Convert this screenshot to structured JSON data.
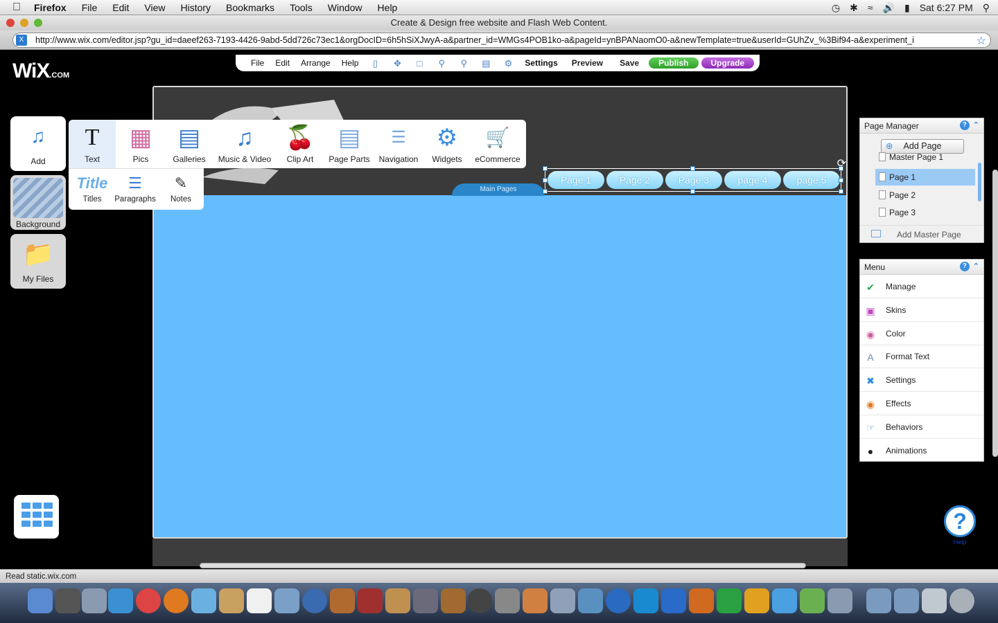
{
  "menubar": {
    "apple": "",
    "app_name": "Firefox",
    "items": [
      "File",
      "Edit",
      "View",
      "History",
      "Bookmarks",
      "Tools",
      "Window",
      "Help"
    ],
    "clock": "Sat 6:27 PM"
  },
  "window": {
    "title": "Create & Design free website and Flash Web Content.",
    "url": "http://www.wix.com/editor.jsp?gu_id=daeef263-7193-4426-9abd-5dd726c73ec1&orgDocID=6h5hSiXJwyA-a&partner_id=WMGs4POB1ko-a&pageId=ynBPANaomO0-a&newTemplate=true&userId=GUhZv_%3Bif94-a&experiment_i"
  },
  "wix": {
    "logo": "WiX",
    "logo_suffix": ".COM",
    "toolbar": {
      "file": "File",
      "edit": "Edit",
      "arrange": "Arrange",
      "help": "Help",
      "settings": "Settings",
      "preview": "Preview",
      "save": "Save",
      "publish": "Publish",
      "upgrade": "Upgrade"
    },
    "side_buttons": {
      "add": "Add",
      "background": "Background",
      "my_files": "My Files"
    },
    "add_categories": [
      {
        "label": "Text",
        "icon": "text-icon"
      },
      {
        "label": "Pics",
        "icon": "pics-icon"
      },
      {
        "label": "Galleries",
        "icon": "galleries-icon"
      },
      {
        "label": "Music & Video",
        "icon": "music-video-icon"
      },
      {
        "label": "Clip Art",
        "icon": "clip-art-icon"
      },
      {
        "label": "Page Parts",
        "icon": "page-parts-icon"
      },
      {
        "label": "Navigation",
        "icon": "navigation-icon"
      },
      {
        "label": "Widgets",
        "icon": "widgets-icon"
      },
      {
        "label": "eCommerce",
        "icon": "ecommerce-icon"
      }
    ],
    "text_subcategories": [
      {
        "label": "Titles",
        "icon": "titles-icon"
      },
      {
        "label": "Paragraphs",
        "icon": "paragraphs-icon"
      },
      {
        "label": "Notes",
        "icon": "notes-icon"
      }
    ],
    "canvas": {
      "main_pages_tab": "Main Pages",
      "nav_pages": [
        "Page 1",
        "Page 2",
        "Page 3",
        "page 4",
        "page 5"
      ],
      "colors": {
        "content": "#66bdfd",
        "header": "#3a3a3a"
      }
    },
    "page_manager": {
      "title": "Page Manager",
      "add_page": "Add Page",
      "pages": [
        "Master Page 1",
        "Page 1",
        "Page 2",
        "Page 3"
      ],
      "selected": "Page 1",
      "add_master_page": "Add Master Page"
    },
    "menu_panel": {
      "title": "Menu",
      "items": [
        {
          "label": "Manage",
          "icon": "manage-icon"
        },
        {
          "label": "Skins",
          "icon": "skins-icon"
        },
        {
          "label": "Color",
          "icon": "color-icon"
        },
        {
          "label": "Format Text",
          "icon": "format-text-icon"
        },
        {
          "label": "Settings",
          "icon": "settings-icon"
        },
        {
          "label": "Effects",
          "icon": "effects-icon"
        },
        {
          "label": "Behaviors",
          "icon": "behaviors-icon"
        },
        {
          "label": "Animations",
          "icon": "animations-icon"
        }
      ]
    },
    "help_label": "Help"
  },
  "statusbar": {
    "text": "Read static.wix.com"
  }
}
